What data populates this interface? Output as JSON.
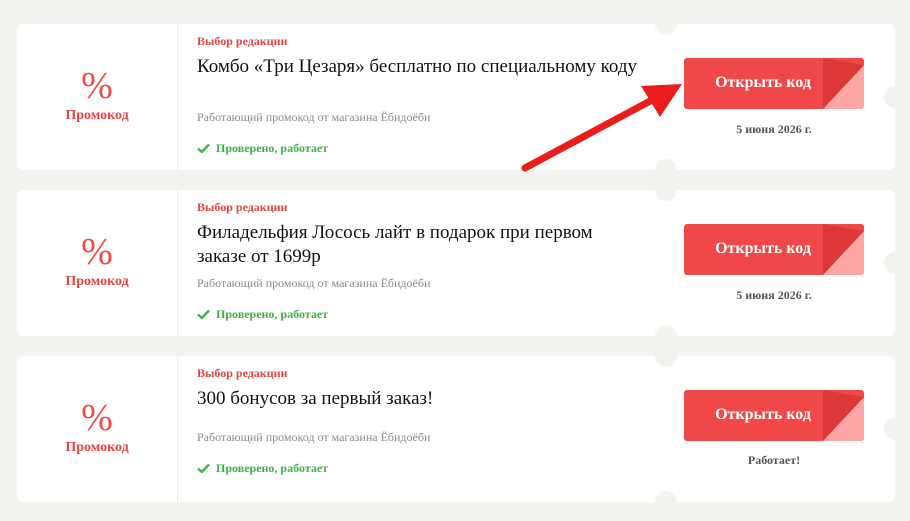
{
  "accent_color": "#f04848",
  "success_color": "#3eb049",
  "coupons": [
    {
      "type_symbol": "%",
      "type_label": "Промокод",
      "editor_badge": "Выбор редакции",
      "title": "Комбо «Три Цезаря» бесплатно по специальному коду",
      "subtitle": "Работающий промокод от магазина Ёбидоёби",
      "verified": "Проверено, работает",
      "button_label": "Открыть код",
      "footer": "5 июня 2026 г."
    },
    {
      "type_symbol": "%",
      "type_label": "Промокод",
      "editor_badge": "Выбор редакции",
      "title": "Филадельфия Лосось лайт в подарок при первом заказе от 1699р",
      "subtitle": "Работающий промокод от магазина Ёбидоёби",
      "verified": "Проверено, работает",
      "button_label": "Открыть код",
      "footer": "5 июня 2026 г."
    },
    {
      "type_symbol": "%",
      "type_label": "Промокод",
      "editor_badge": "Выбор редакции",
      "title": "300 бонусов за первый заказ!",
      "subtitle": "Работающий промокод от магазина Ёбидоёби",
      "verified": "Проверено, работает",
      "button_label": "Открыть код",
      "footer": "Работает!"
    }
  ]
}
